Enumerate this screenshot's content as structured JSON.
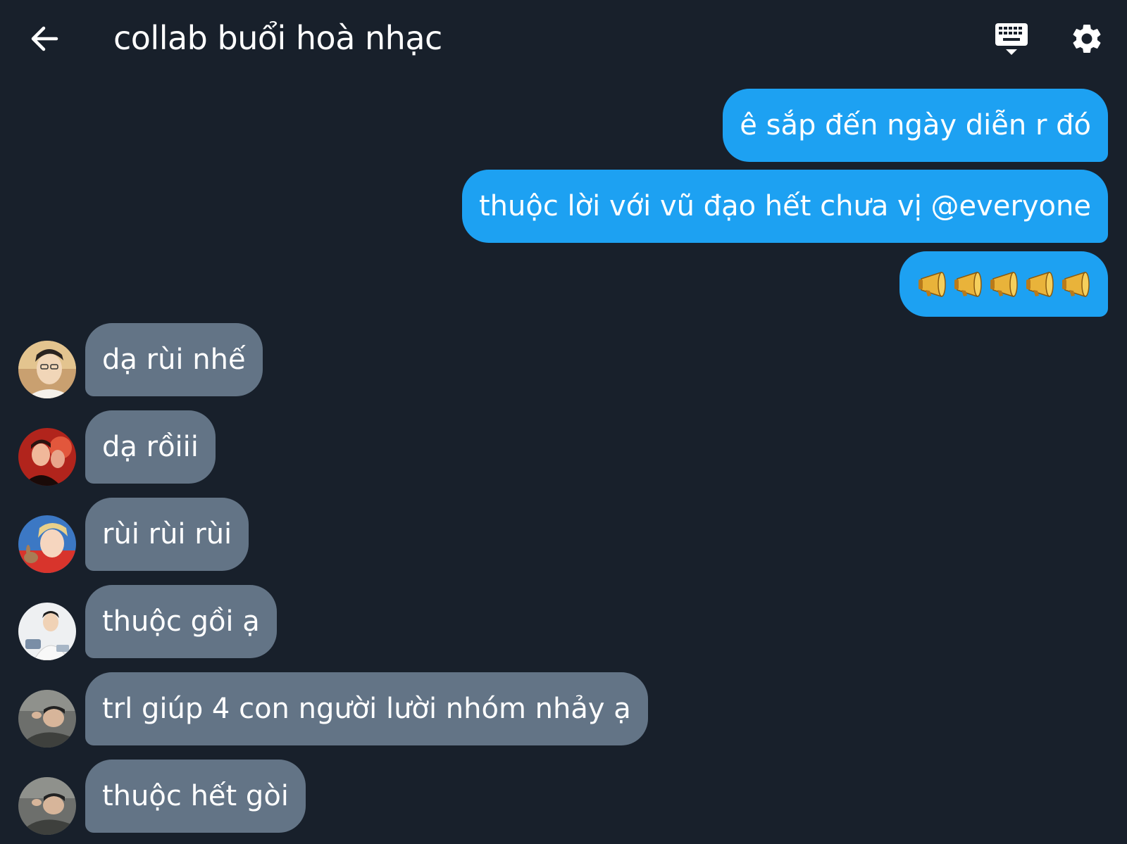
{
  "header": {
    "title": "collab buổi hoà nhạc"
  },
  "outgoing": [
    {
      "text": "ê sắp đến ngày diễn r đó"
    },
    {
      "text": "thuộc lời với vũ đạo hết chưa vị @everyone"
    },
    {
      "emoji": [
        "megaphone",
        "megaphone",
        "megaphone",
        "megaphone",
        "megaphone"
      ]
    }
  ],
  "incoming": [
    {
      "text": "dạ rùi nhế"
    },
    {
      "text": "dạ rồiii"
    },
    {
      "text": "rùi rùi rùi"
    },
    {
      "text": "thuộc gồi ạ"
    },
    {
      "text": "trl giúp 4 con người lười nhóm nhảy ạ"
    },
    {
      "text": "thuộc hết gòi"
    }
  ],
  "colors": {
    "background": "#18202b",
    "outgoing_bubble": "#1da1f2",
    "incoming_bubble": "#637486"
  },
  "icons": {
    "back": "arrow-left-icon",
    "keyboard": "keyboard-icon",
    "settings": "gear-icon",
    "megaphone": "megaphone-icon"
  }
}
